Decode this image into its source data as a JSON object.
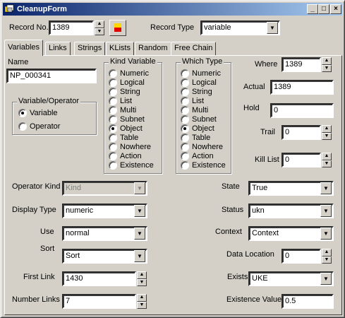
{
  "window": {
    "title": "CleanupForm"
  },
  "record": {
    "no_label": "Record No.",
    "no_value": "1389",
    "type_label": "Record Type",
    "type_value": "variable"
  },
  "tabs": [
    "Variables",
    "Links",
    "Strings",
    "KLists",
    "Random",
    "Free Chain"
  ],
  "name": {
    "label": "Name",
    "value": "NP_000341"
  },
  "var_operator": {
    "title": "Variable/Operator",
    "options": [
      "Variable",
      "Operator"
    ],
    "selected": "Variable"
  },
  "kind_variable": {
    "title": "Kind Variable",
    "options": [
      "Numeric",
      "Logical",
      "String",
      "List",
      "Multi",
      "Subnet",
      "Object",
      "Table",
      "Nowhere",
      "Action",
      "Existence"
    ],
    "selected": "Object"
  },
  "which_type": {
    "title": "Which Type",
    "options": [
      "Numeric",
      "Logical",
      "String",
      "List",
      "Multi",
      "Subnet",
      "Object",
      "Table",
      "Nowhere",
      "Action",
      "Existence"
    ],
    "selected": "Object"
  },
  "right_fields": {
    "where": {
      "label": "Where",
      "value": "1389"
    },
    "actual": {
      "label": "Actual",
      "value": "1389"
    },
    "hold": {
      "label": "Hold",
      "value": "0"
    },
    "trail": {
      "label": "Trail",
      "value": "0"
    },
    "kill_list": {
      "label": "Kill List",
      "value": "0"
    }
  },
  "left_fields": {
    "operator_kind": {
      "label": "Operator Kind",
      "value": "Kind"
    },
    "display_type": {
      "label": "Display Type",
      "value": "numeric"
    },
    "use": {
      "label": "Use",
      "value": "normal"
    },
    "sort": {
      "label": "Sort",
      "value": "Sort"
    },
    "first_link": {
      "label": "First Link",
      "value": "1430"
    },
    "number_links": {
      "label": "Number Links",
      "value": "7"
    }
  },
  "right_lower": {
    "state": {
      "label": "State",
      "value": "True"
    },
    "status": {
      "label": "Status",
      "value": "ukn"
    },
    "context": {
      "label": "Context",
      "value": "Context"
    },
    "data_location": {
      "label": "Data Location",
      "value": "0"
    },
    "exists": {
      "label": "Exists",
      "value": "UKE"
    },
    "existence_value": {
      "label": "Existence Value",
      "value": "0.5"
    }
  }
}
